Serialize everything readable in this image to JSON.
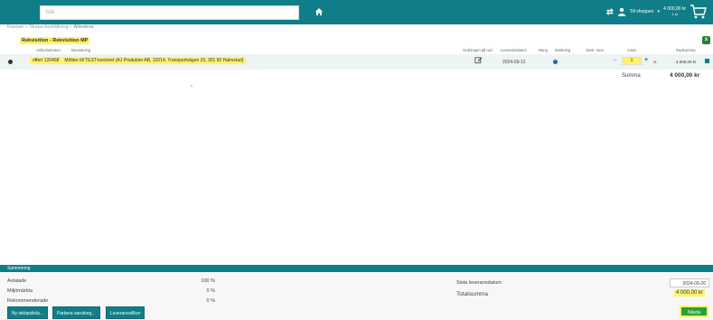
{
  "topbar": {
    "search_placeholder": "Sök",
    "shop_label": "Till shoppen",
    "amount": "4 000,00 kr",
    "amount_sub": "1 st"
  },
  "breadcrumb": [
    "Kassan",
    "Skapa beställning",
    "Attestera"
  ],
  "requisition": {
    "title": "Rekvisition - Rekvisition MP"
  },
  "table": {
    "headers": {
      "article": "Artikelnummer",
      "description": "Benämning",
      "order": "Ordningen på rad",
      "delivery_date": "Leveransdatum",
      "brand": "Rang",
      "marking": "Märkning",
      "best_sort": "Best. sora",
      "qty": "Antal",
      "row_sum": "Radsumma"
    },
    "row": {
      "article": "offert 120468",
      "description": "Möbler till TEST-kontoret (AJ Produkter AB, 10214, Transportvägen 23, 301 82 Halmstad)",
      "delivery_date": "2024-09-12",
      "qty": "1",
      "unit": "st",
      "amount": "4 000,00 kr"
    },
    "sum_label": "Summa",
    "sum_value": "4 000,00 kr"
  },
  "footer": {
    "title": "Summering",
    "rows": [
      {
        "label": "Avtalade",
        "value": "100 %"
      },
      {
        "label": "Miljömärkta",
        "value": "0 %"
      },
      {
        "label": "Rekommenderade",
        "value": "0 %"
      }
    ],
    "latest_delivery_label": "Sista leveransdatum",
    "latest_delivery_value": "2024-09-20",
    "total_label": "Totalsumma",
    "total_value": "4 000,00 kr",
    "buttons": {
      "new_order": "Ny inköpslista...",
      "park": "Parkera varukorg...",
      "conditions": "Leveransvillkor",
      "next": "Nästa"
    }
  },
  "colors": {
    "brand": "#0f7e88",
    "highlight": "#fff36b",
    "next_button": "#2e9d3a"
  }
}
